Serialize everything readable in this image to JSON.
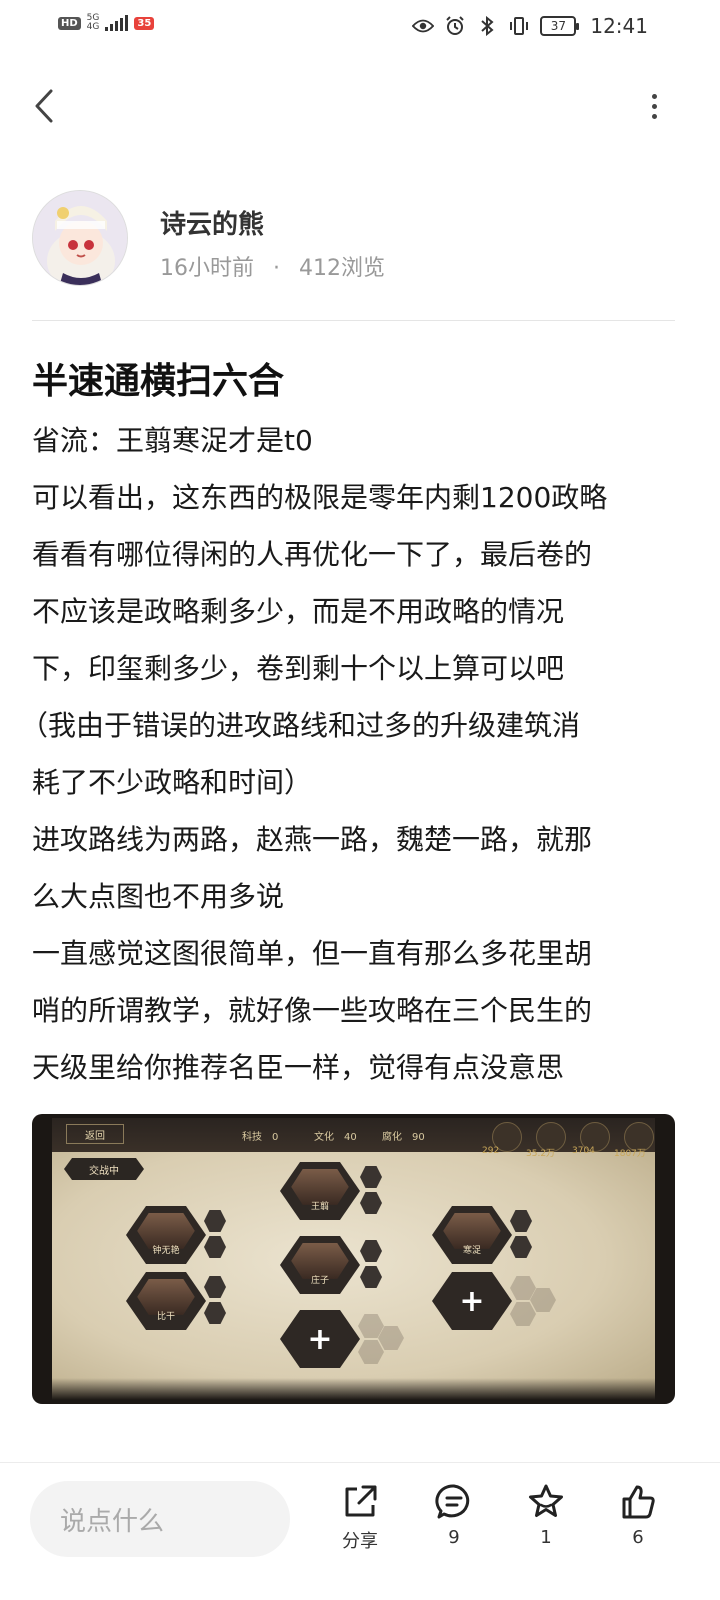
{
  "status_bar": {
    "hd": "HD",
    "net_top": "5G",
    "net_bottom": "4G",
    "app_badge": "35",
    "battery": "37",
    "time": "12:41"
  },
  "author": {
    "name": "诗云的熊",
    "time_ago": "16小时前",
    "separator": "·",
    "views": "412浏览"
  },
  "post": {
    "title": "半速通横扫六合",
    "lines": [
      "省流：王翦寒浞才是t0",
      "可以看出，这东西的极限是零年内剩1200政略",
      "看看有哪位得闲的人再优化一下了，最后卷的",
      "不应该是政略剩多少，而是不用政略的情况",
      "下，印玺剩多少，卷到剩十个以上算可以吧",
      "（我由于错误的进攻路线和过多的升级建筑消",
      "耗了不少政略和时间）",
      "进攻路线为两路，赵燕一路，魏楚一路，就那",
      "么大点图也不用多说",
      "一直感觉这图很简单，但一直有那么多花里胡",
      "哨的所谓教学，就好像一些攻略在三个民生的",
      "天级里给你推荐名臣一样，觉得有点没意思"
    ]
  },
  "game_image": {
    "back_label": "返回",
    "stat_tech": "科技　0",
    "stat_culture": "文化　40",
    "stat_corrupt": "腐化　90",
    "res1": "292",
    "res2": "35.2万",
    "res3": "3704",
    "res4": "1807万",
    "tag": "交战中",
    "cards": [
      {
        "name": "王翦"
      },
      {
        "name": "钟无艳"
      },
      {
        "name": "寒浞"
      },
      {
        "name": "庄子"
      },
      {
        "name": "比干"
      }
    ],
    "plus_symbol": "+"
  },
  "bottom_bar": {
    "comment_placeholder": "说点什么",
    "share_label": "分享",
    "comment_count": "9",
    "favorite_count": "1",
    "like_count": "6"
  },
  "colors": {
    "accent_text": "#1a1a1a",
    "meta_gray": "#999999",
    "input_bg": "#f3f3f3"
  }
}
